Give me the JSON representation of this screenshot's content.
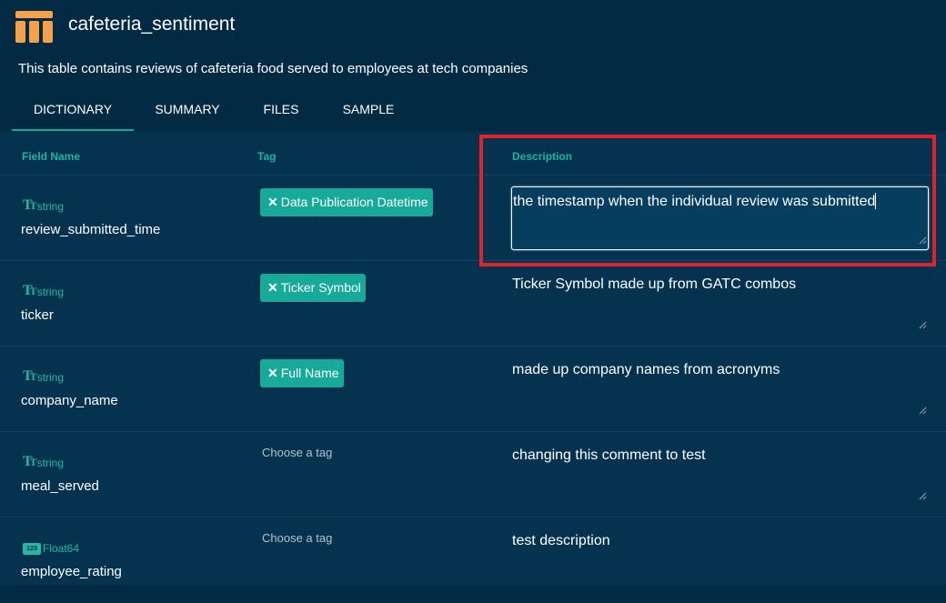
{
  "header": {
    "title": "cafeteria_sentiment",
    "description": "This table contains reviews of cafeteria food served to employees at tech companies",
    "logo_icon": "table-icon",
    "logo_color": "#f5a04b"
  },
  "tabs": [
    {
      "label": "DICTIONARY",
      "active": true
    },
    {
      "label": "SUMMARY",
      "active": false
    },
    {
      "label": "FILES",
      "active": false
    },
    {
      "label": "SAMPLE",
      "active": false
    }
  ],
  "columns": {
    "field_name": "Field Name",
    "tag": "Tag",
    "description": "Description"
  },
  "rows": [
    {
      "type": "string",
      "type_icon": "text-type-icon",
      "name": "review_submitted_time",
      "tag": "Data Publication Datetime",
      "description": "the timestamp when the individual review was submitted",
      "editing": true
    },
    {
      "type": "string",
      "type_icon": "text-type-icon",
      "name": "ticker",
      "tag": "Ticker Symbol",
      "description": "Ticker Symbol made up from GATC combos",
      "editing": false
    },
    {
      "type": "string",
      "type_icon": "text-type-icon",
      "name": "company_name",
      "tag": "Full Name",
      "description": "made up company names from acronyms",
      "editing": false
    },
    {
      "type": "string",
      "type_icon": "text-type-icon",
      "name": "meal_served",
      "tag": null,
      "tag_placeholder": "Choose a tag",
      "description": "changing this comment to test",
      "editing": false
    },
    {
      "type": "Float64",
      "type_icon": "numeric-type-icon",
      "type_icon_text": "123",
      "name": "employee_rating",
      "tag": null,
      "tag_placeholder": "Choose a tag",
      "description": "test description",
      "editing": false
    }
  ],
  "colors": {
    "background": "#022a42",
    "table_background": "#05334f",
    "accent": "#17a99a",
    "highlight": "#e0232a"
  }
}
